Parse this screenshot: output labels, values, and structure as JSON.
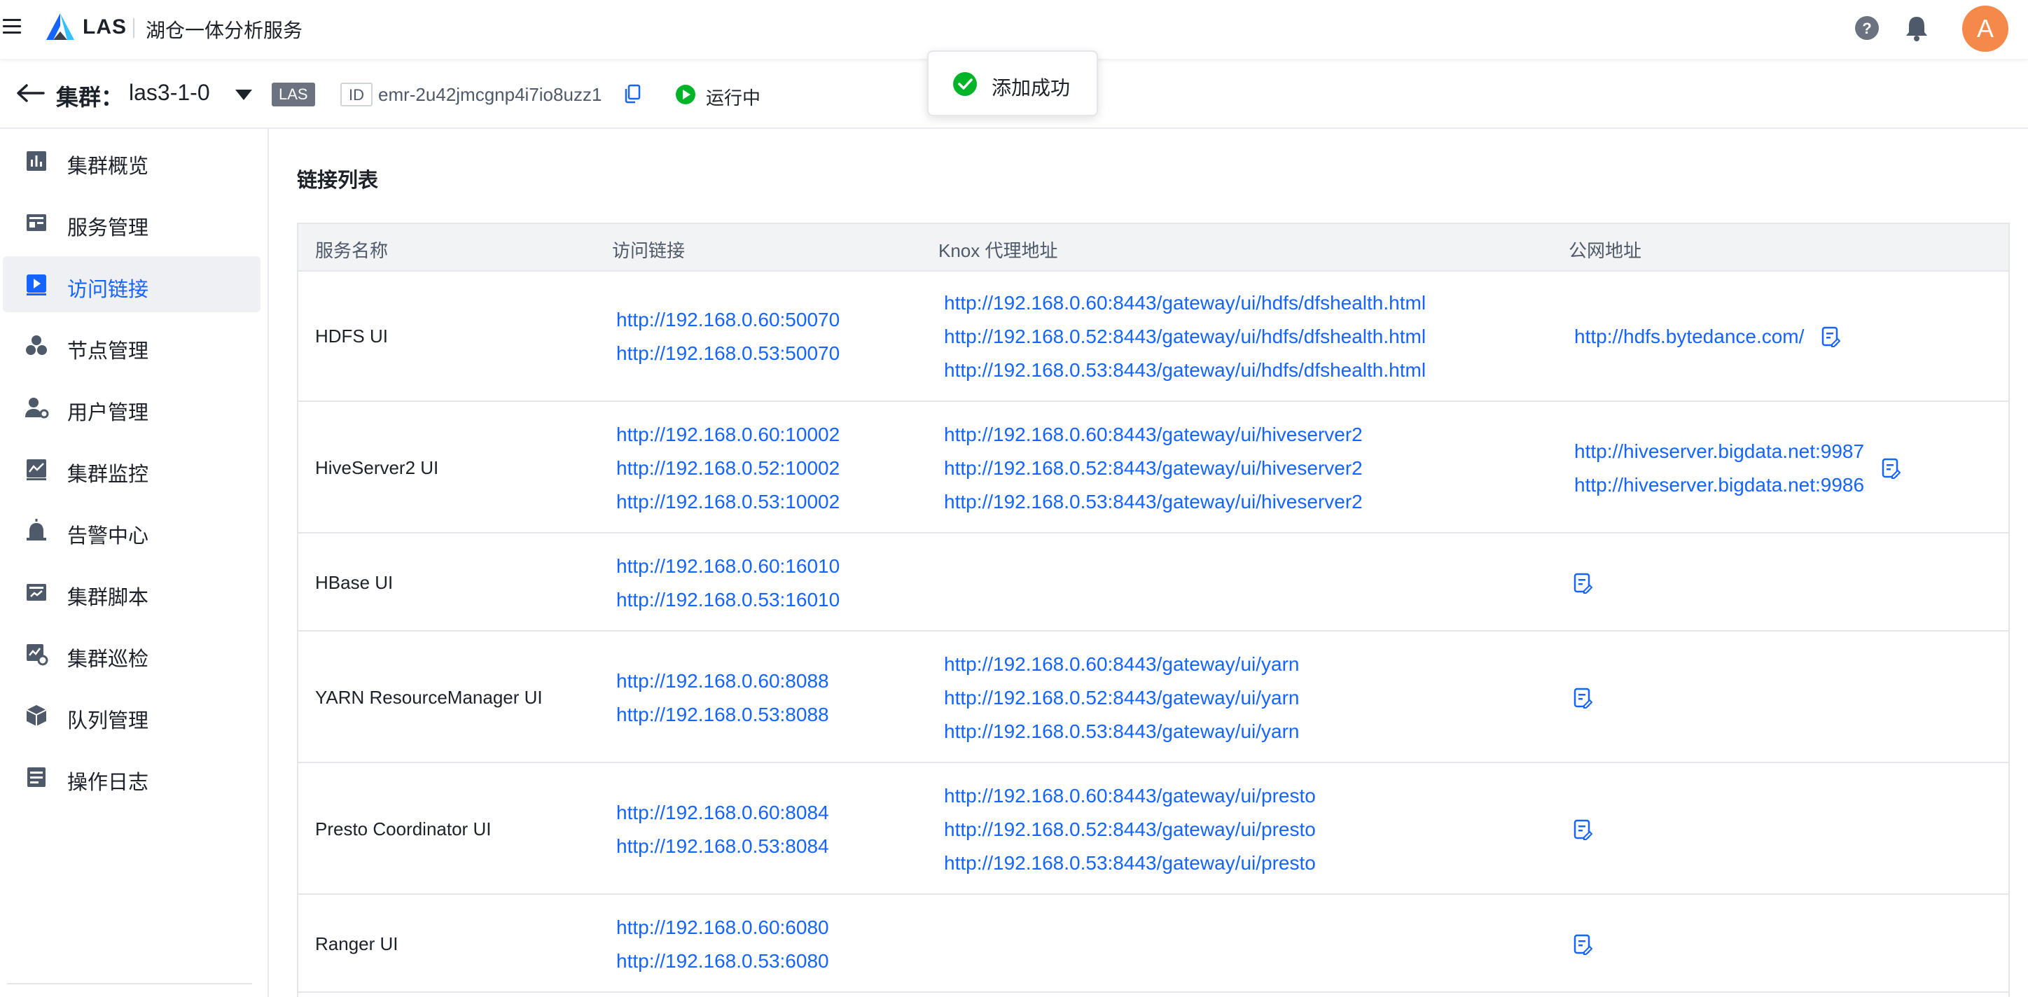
{
  "topbar": {
    "brand": "LAS",
    "app_name": "湖仓一体分析服务",
    "avatar_letter": "A"
  },
  "cluster": {
    "label": "集群：",
    "name": "las3-1-0",
    "tag": "LAS",
    "id_label": "ID",
    "id": "emr-2u42jmcgnp4i7io8uzz1",
    "status": "运行中"
  },
  "toast": {
    "message": "添加成功"
  },
  "sidebar": {
    "items": [
      {
        "label": "集群概览",
        "icon": "chart-bar-icon"
      },
      {
        "label": "服务管理",
        "icon": "service-grid-icon"
      },
      {
        "label": "访问链接",
        "icon": "play-link-icon",
        "active": true
      },
      {
        "label": "节点管理",
        "icon": "nodes-icon"
      },
      {
        "label": "用户管理",
        "icon": "user-gear-icon"
      },
      {
        "label": "集群监控",
        "icon": "monitor-chart-icon"
      },
      {
        "label": "告警中心",
        "icon": "alarm-icon"
      },
      {
        "label": "集群脚本",
        "icon": "script-icon"
      },
      {
        "label": "集群巡检",
        "icon": "inspect-icon"
      },
      {
        "label": "队列管理",
        "icon": "cube-icon"
      },
      {
        "label": "操作日志",
        "icon": "log-icon"
      }
    ]
  },
  "main": {
    "section_title": "链接列表",
    "columns": [
      "服务名称",
      "访问链接",
      "Knox 代理地址",
      "公网地址"
    ],
    "rows": [
      {
        "name": "HDFS UI",
        "access": [
          "http://192.168.0.60:50070",
          "http://192.168.0.53:50070"
        ],
        "knox": [
          "http://192.168.0.60:8443/gateway/ui/hdfs/dfshealth.html",
          "http://192.168.0.52:8443/gateway/ui/hdfs/dfshealth.html",
          "http://192.168.0.53:8443/gateway/ui/hdfs/dfshealth.html"
        ],
        "public": [
          "http://hdfs.bytedance.com/"
        ]
      },
      {
        "name": "HiveServer2 UI",
        "access": [
          "http://192.168.0.60:10002",
          "http://192.168.0.52:10002",
          "http://192.168.0.53:10002"
        ],
        "knox": [
          "http://192.168.0.60:8443/gateway/ui/hiveserver2",
          "http://192.168.0.52:8443/gateway/ui/hiveserver2",
          "http://192.168.0.53:8443/gateway/ui/hiveserver2"
        ],
        "public": [
          "http://hiveserver.bigdata.net:9987",
          "http://hiveserver.bigdata.net:9986"
        ]
      },
      {
        "name": "HBase UI",
        "access": [
          "http://192.168.0.60:16010",
          "http://192.168.0.53:16010"
        ],
        "knox": [],
        "public": []
      },
      {
        "name": "YARN ResourceManager UI",
        "access": [
          "http://192.168.0.60:8088",
          "http://192.168.0.53:8088"
        ],
        "knox": [
          "http://192.168.0.60:8443/gateway/ui/yarn",
          "http://192.168.0.52:8443/gateway/ui/yarn",
          "http://192.168.0.53:8443/gateway/ui/yarn"
        ],
        "public": []
      },
      {
        "name": "Presto Coordinator UI",
        "access": [
          "http://192.168.0.60:8084",
          "http://192.168.0.53:8084"
        ],
        "knox": [
          "http://192.168.0.60:8443/gateway/ui/presto",
          "http://192.168.0.52:8443/gateway/ui/presto",
          "http://192.168.0.53:8443/gateway/ui/presto"
        ],
        "public": []
      },
      {
        "name": "Ranger UI",
        "access": [
          "http://192.168.0.60:6080",
          "http://192.168.0.53:6080"
        ],
        "knox": [],
        "public": []
      }
    ]
  },
  "colors": {
    "link": "#1664ff",
    "success": "#00b42a",
    "avatar": "#f5894a"
  }
}
